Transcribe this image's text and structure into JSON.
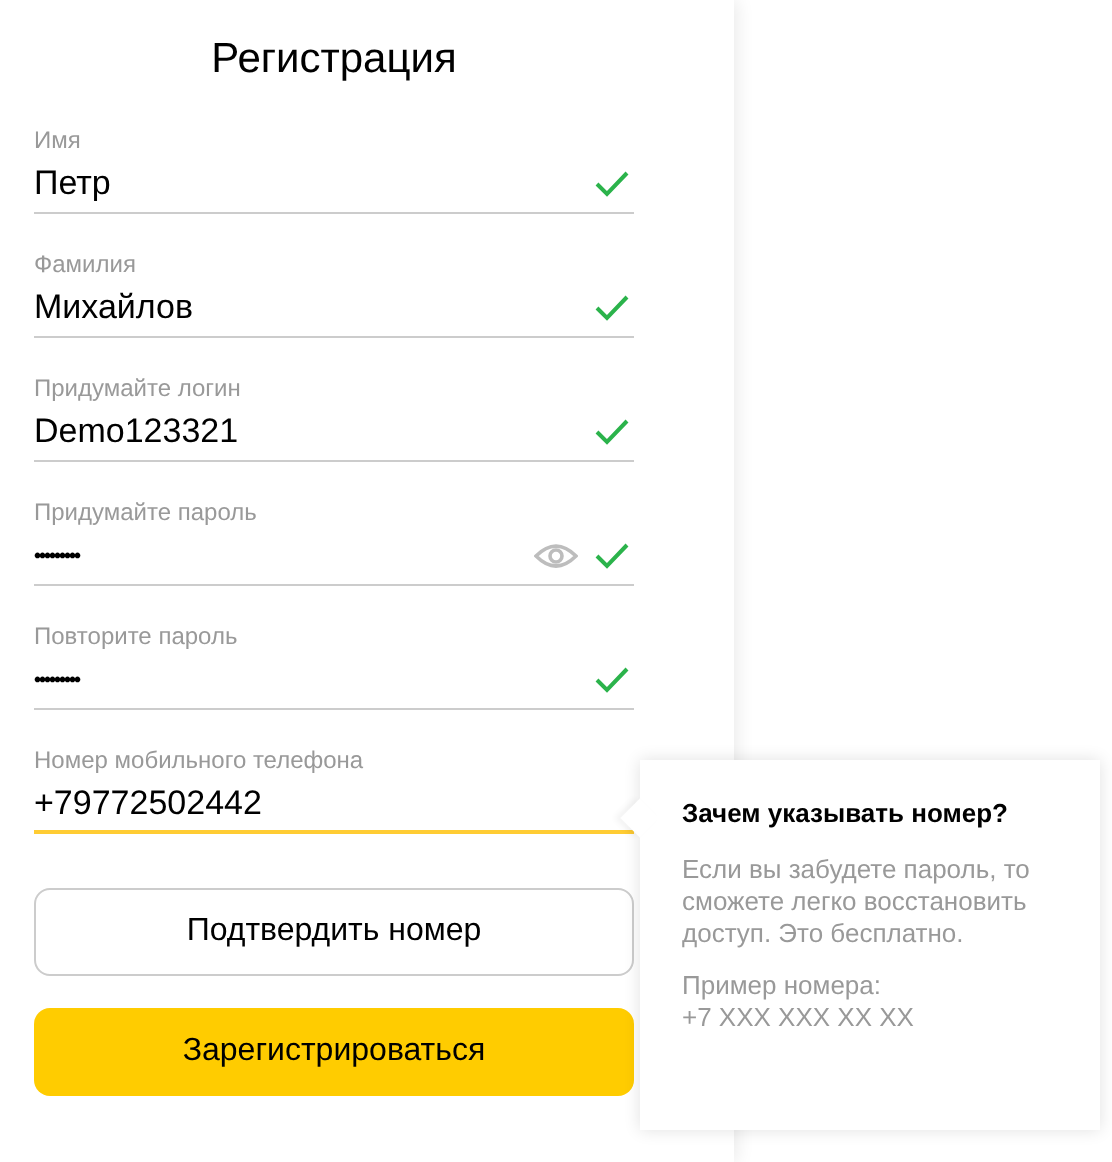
{
  "title": "Регистрация",
  "fields": [
    {
      "label": "Имя",
      "value": "Петр",
      "kind": "text",
      "valid": true,
      "focused": false
    },
    {
      "label": "Фамилия",
      "value": "Михайлов",
      "kind": "text",
      "valid": true,
      "focused": false
    },
    {
      "label": "Придумайте логин",
      "value": "Demo123321",
      "kind": "text",
      "valid": true,
      "focused": false
    },
    {
      "label": "Придумайте пароль",
      "value": "•••••••••",
      "kind": "password",
      "eye": true,
      "valid": true,
      "focused": false
    },
    {
      "label": "Повторите пароль",
      "value": "•••••••••",
      "kind": "password",
      "eye": false,
      "valid": true,
      "focused": false
    },
    {
      "label": "Номер мобильного телефона",
      "value": "+79772502442",
      "kind": "text",
      "valid": false,
      "focused": true
    }
  ],
  "buttons": [
    {
      "label": "Подтвердить номер",
      "kind": "secondary"
    },
    {
      "label": "Зарегистрироваться",
      "kind": "primary"
    }
  ],
  "hint": {
    "title": "Зачем указывать номер?",
    "text": "Если вы забудете пароль, то сможете легко восстановить доступ. Это бесплатно.",
    "example": "Пример номера:\n+7 XXX XXX XX XX"
  }
}
